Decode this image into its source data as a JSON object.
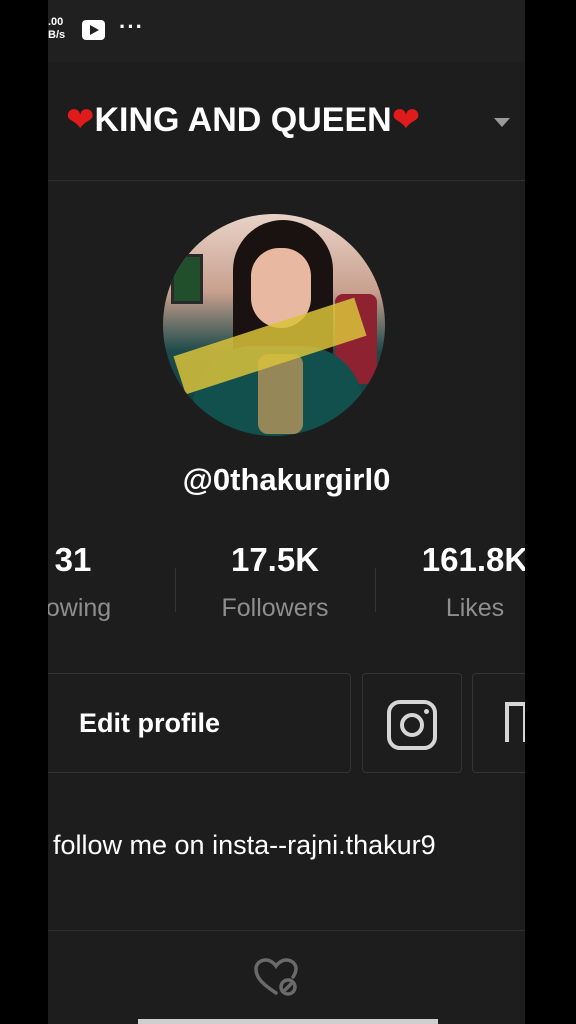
{
  "status_bar": {
    "net_speed_value": ".00",
    "net_speed_unit": "B/s",
    "youtube_icon": "youtube-play-icon",
    "overflow": "···"
  },
  "header": {
    "title": "KING AND QUEEN",
    "heart": "❤",
    "heart_color": "#e01b1b",
    "dropdown_icon": "chevron-down-icon"
  },
  "profile": {
    "username": "@0thakurgirl0",
    "stats": [
      {
        "value": "31",
        "label": "llowing"
      },
      {
        "value": "17.5K",
        "label": "Followers"
      },
      {
        "value": "161.8K",
        "label": "Likes"
      }
    ],
    "edit_button": "Edit profile",
    "bio": "follow me on insta--rajni.thakur9"
  },
  "colors": {
    "background": "#1d1d1d",
    "label_gray": "#8e8e8e"
  }
}
